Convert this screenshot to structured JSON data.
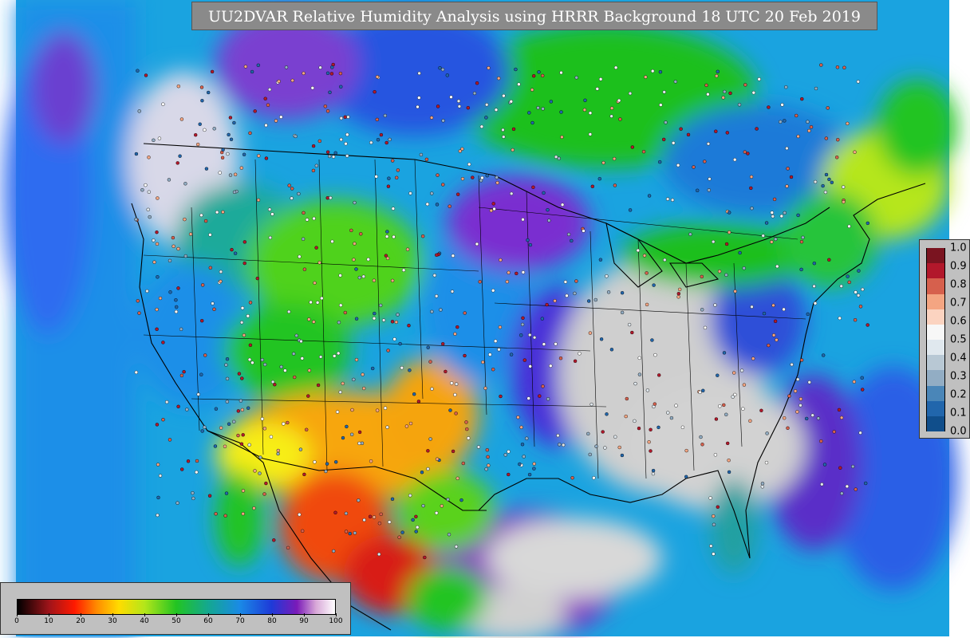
{
  "title": "UU2DVAR Relative Humidity Analysis using HRRR Background 18 UTC 20 Feb 2019",
  "humidity_colorbar": {
    "ticks": [
      "0",
      "10",
      "20",
      "30",
      "40",
      "50",
      "60",
      "70",
      "80",
      "90",
      "100"
    ],
    "min": 0,
    "max": 100
  },
  "observation_colorbar": {
    "ticks": [
      "1.0",
      "0.9",
      "0.8",
      "0.7",
      "0.6",
      "0.5",
      "0.4",
      "0.3",
      "0.2",
      "0.1",
      "0.0"
    ],
    "colors": [
      "#7a1420",
      "#b2182b",
      "#d6604d",
      "#f4a582",
      "#fbd3c0",
      "#f7f7f7",
      "#e0e8ee",
      "#b8c8d4",
      "#92adc4",
      "#4a86b8",
      "#2166ac",
      "#104e8b"
    ]
  },
  "colors": {
    "land_dry": "#f5a40a",
    "land_moist": "#22c422",
    "land_wet": "#1e40d8",
    "saturated": "#cfcfcf",
    "ocean": "#19a6e6",
    "boundary": "#000000"
  }
}
